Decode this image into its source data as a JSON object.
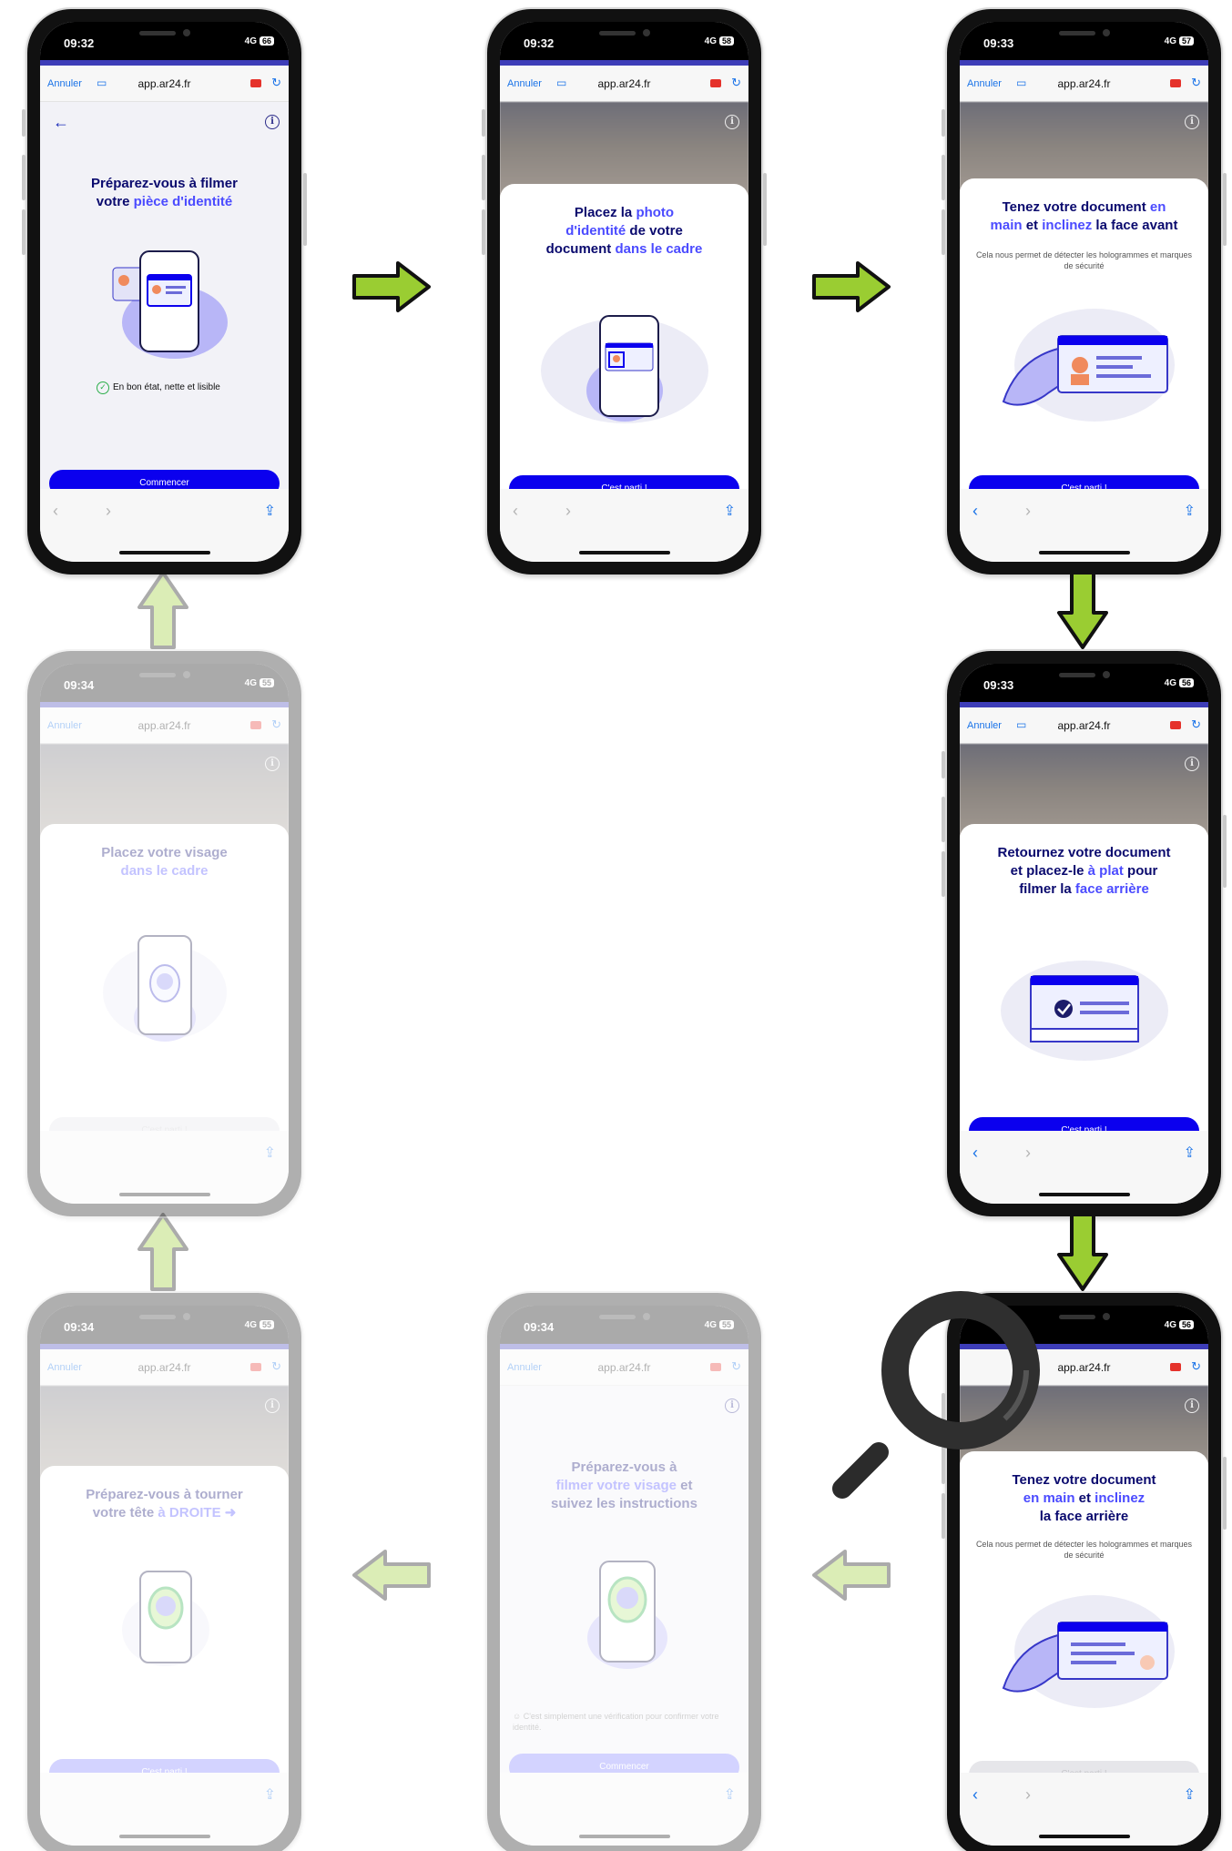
{
  "browser": {
    "cancel_label": "Annuler",
    "url": "app.ar24.fr"
  },
  "phones": [
    {
      "time": "09:32",
      "network": "4G",
      "battery": "66",
      "heading_parts": [
        "Préparez-vous à filmer",
        "votre ",
        "pièce d'identité"
      ],
      "checklist_item": "En bon état, nette et lisible",
      "cta": "Commencer"
    },
    {
      "time": "09:32",
      "network": "4G",
      "battery": "58",
      "heading_parts": [
        "Placez la ",
        "photo",
        "d'identité",
        " de votre",
        "document ",
        "dans le cadre"
      ],
      "cta": "C'est parti !"
    },
    {
      "time": "09:33",
      "network": "4G",
      "battery": "57",
      "heading_parts": [
        "Tenez votre document ",
        "en",
        "main",
        " et ",
        "inclinez",
        " la face avant"
      ],
      "subtitle": "Cela nous permet de détecter les hologrammes et marques de sécurité",
      "cta": "C'est parti !"
    },
    {
      "time": "09:33",
      "network": "4G",
      "battery": "56",
      "heading_parts": [
        "Retournez votre document",
        "et placez-le ",
        "à plat",
        " pour",
        "filmer la ",
        "face arrière"
      ],
      "cta": "C'est parti !"
    },
    {
      "time": "",
      "network": "4G",
      "battery": "56",
      "heading_parts": [
        "Tenez votre document",
        "en main",
        " et ",
        "inclinez",
        "la face arrière"
      ],
      "subtitle": "Cela nous permet de détecter les hologrammes et marques de sécurité",
      "cta": "C'est parti !"
    },
    {
      "time": "09:34",
      "network": "4G",
      "battery": "55",
      "heading_parts": [
        "Préparez-vous à",
        "filmer votre visage",
        " et",
        "suivez les instructions"
      ],
      "note": "C'est simplement une vérification pour confirmer votre identité.",
      "cta": "Commencer"
    },
    {
      "time": "09:34",
      "network": "4G",
      "battery": "55",
      "heading_parts": [
        "Préparez-vous à tourner",
        "votre tête ",
        "à DROITE ➜"
      ],
      "cta": "C'est parti !"
    },
    {
      "time": "09:34",
      "network": "4G",
      "battery": "55",
      "heading_parts": [
        "Placez votre visage",
        "dans le cadre"
      ],
      "cta": "C'est parti !"
    }
  ],
  "colors": {
    "accent": "#0b00ee",
    "heading": "#0a0a6e",
    "highlight": "#4b4bff",
    "arrow_fill": "#9acd32",
    "check": "#2cae4a"
  },
  "icons": {
    "arrow": "green-arrow-icon",
    "magnifier": "magnifier-icon",
    "info": "info-icon",
    "share": "share-icon"
  }
}
